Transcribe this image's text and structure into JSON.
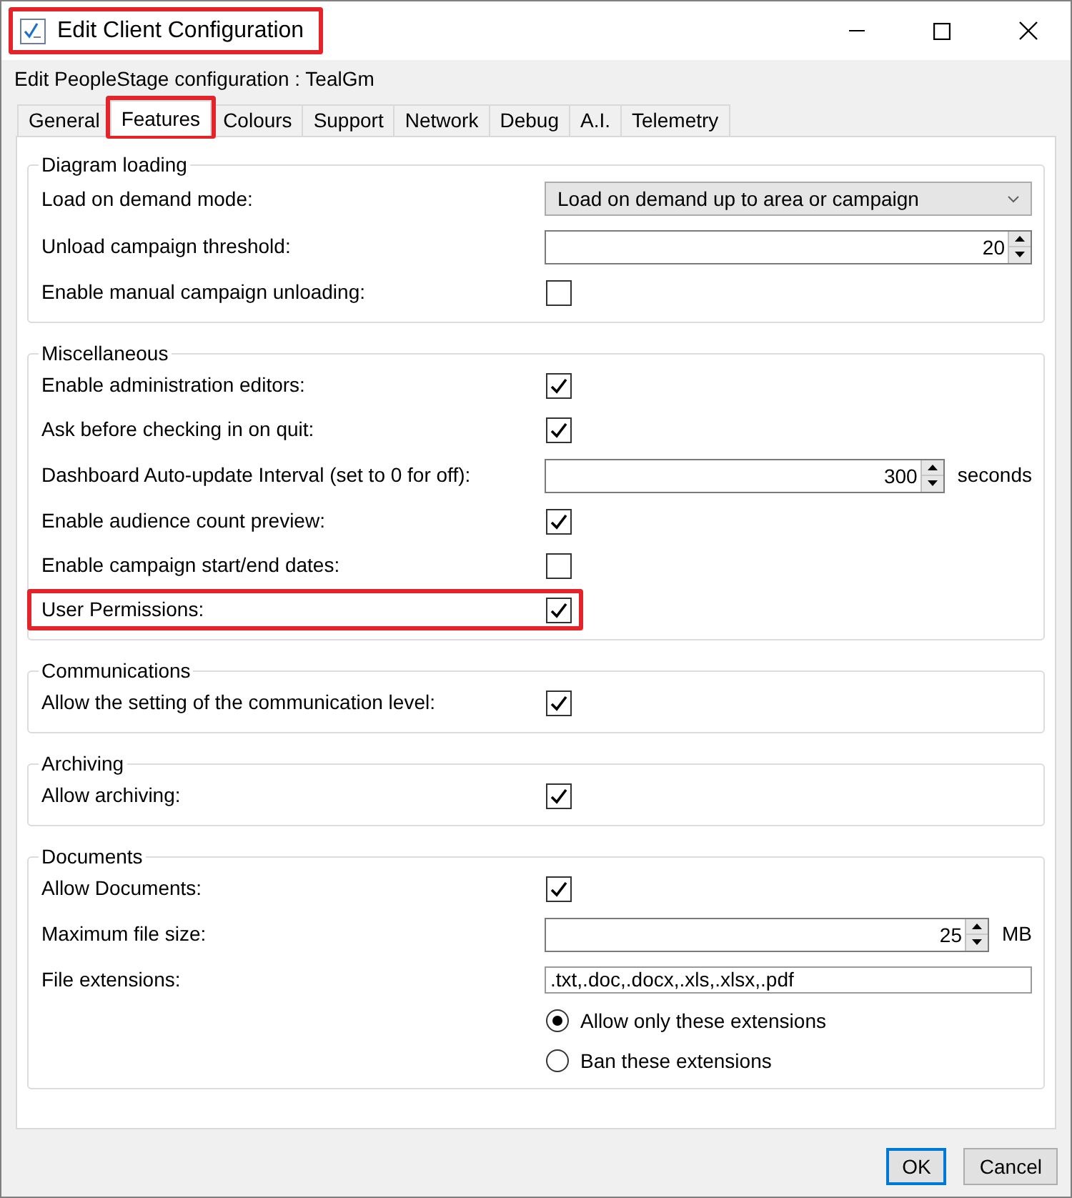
{
  "window": {
    "title": "Edit Client Configuration",
    "highlighted": true
  },
  "subtitle": "Edit PeopleStage configuration : TealGm",
  "tabs": [
    {
      "label": "General",
      "selected": false,
      "highlighted": false
    },
    {
      "label": "Features",
      "selected": true,
      "highlighted": true
    },
    {
      "label": "Colours",
      "selected": false,
      "highlighted": false
    },
    {
      "label": "Support",
      "selected": false,
      "highlighted": false
    },
    {
      "label": "Network",
      "selected": false,
      "highlighted": false
    },
    {
      "label": "Debug",
      "selected": false,
      "highlighted": false
    },
    {
      "label": "A.I.",
      "selected": false,
      "highlighted": false
    },
    {
      "label": "Telemetry",
      "selected": false,
      "highlighted": false
    }
  ],
  "groups": [
    {
      "title": "Diagram loading",
      "rows": [
        {
          "kind": "dropdown",
          "label": "Load on demand mode:",
          "value": "Load on demand up to area or campaign",
          "highlighted": false
        },
        {
          "kind": "spin",
          "label": "Unload campaign threshold:",
          "value": "20",
          "highlighted": false
        },
        {
          "kind": "checkbox",
          "label": "Enable manual campaign unloading:",
          "checked": false,
          "highlighted": false
        }
      ]
    },
    {
      "title": "Miscellaneous",
      "rows": [
        {
          "kind": "checkbox",
          "label": "Enable administration editors:",
          "checked": true,
          "highlighted": false
        },
        {
          "kind": "checkbox",
          "label": "Ask before checking in on quit:",
          "checked": true,
          "highlighted": false
        },
        {
          "kind": "spin",
          "label": "Dashboard Auto-update Interval (set to 0 for off):",
          "value": "300",
          "unit": "seconds",
          "highlighted": false
        },
        {
          "kind": "checkbox",
          "label": "Enable audience count preview:",
          "checked": true,
          "highlighted": false
        },
        {
          "kind": "checkbox",
          "label": "Enable campaign start/end dates:",
          "checked": false,
          "highlighted": false
        },
        {
          "kind": "checkbox",
          "label": "User Permissions:",
          "checked": true,
          "highlighted": true
        }
      ]
    },
    {
      "title": "Communications",
      "rows": [
        {
          "kind": "checkbox",
          "label": "Allow the setting of the communication level:",
          "checked": true,
          "highlighted": false
        }
      ]
    },
    {
      "title": "Archiving",
      "rows": [
        {
          "kind": "checkbox",
          "label": "Allow archiving:",
          "checked": true,
          "highlighted": false
        }
      ]
    },
    {
      "title": "Documents",
      "rows": [
        {
          "kind": "checkbox",
          "label": "Allow Documents:",
          "checked": true,
          "highlighted": false
        },
        {
          "kind": "spin",
          "label": "Maximum file size:",
          "value": "25",
          "unit": "MB",
          "highlighted": false
        },
        {
          "kind": "text",
          "label": "File extensions:",
          "value": ".txt,.doc,.docx,.xls,.xlsx,.pdf",
          "highlighted": false
        },
        {
          "kind": "radio",
          "label": "Allow only these extensions",
          "selected": true,
          "highlighted": false
        },
        {
          "kind": "radio",
          "label": "Ban these extensions",
          "selected": false,
          "highlighted": false
        }
      ]
    }
  ],
  "buttons": [
    {
      "label": "OK",
      "default": true
    },
    {
      "label": "Cancel",
      "default": false
    }
  ]
}
